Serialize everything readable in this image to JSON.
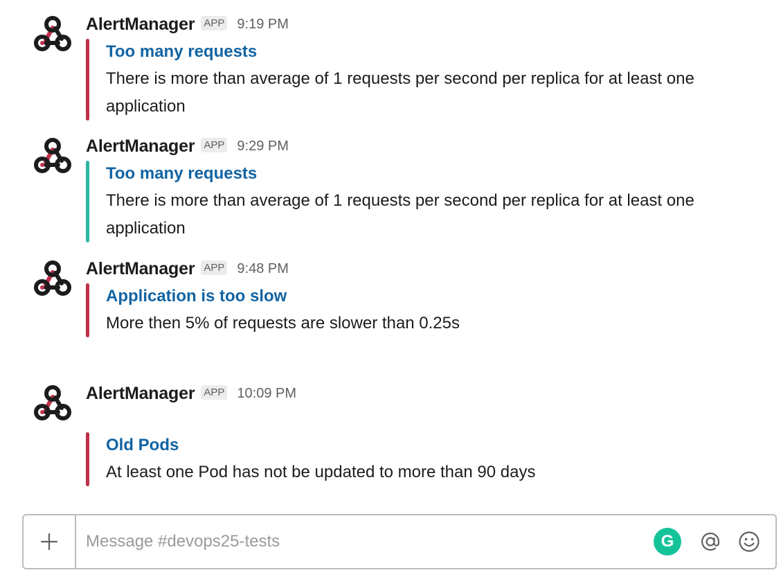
{
  "colors": {
    "alert_red": "#c0304a",
    "resolved_green": "#2eb6a4",
    "link_blue": "#1264a3",
    "grammarly_green": "#15c39a"
  },
  "messages": [
    {
      "sender": "AlertManager",
      "badge": "APP",
      "time": "9:19 PM",
      "avatar_icon": "webhook-icon",
      "attachment": {
        "color": "#c0304a",
        "title": "Too many requests",
        "text": "There is more than average of 1 requests per second per replica for at least one application"
      }
    },
    {
      "sender": "AlertManager",
      "badge": "APP",
      "time": "9:29 PM",
      "avatar_icon": "webhook-icon",
      "attachment": {
        "color": "#2eb6a4",
        "title": "Too many requests",
        "text": "There is more than average of 1 requests per second per replica for at least one application"
      }
    },
    {
      "sender": "AlertManager",
      "badge": "APP",
      "time": "9:48 PM",
      "avatar_icon": "webhook-icon",
      "attachment": {
        "color": "#c0304a",
        "title": "Application is too slow",
        "text": "More then 5% of requests are slower than 0.25s"
      }
    },
    {
      "sender": "AlertManager",
      "badge": "APP",
      "time": "10:09 PM",
      "avatar_icon": "webhook-icon",
      "attachment": {
        "color": "#c0304a",
        "title": "Old Pods",
        "text": "At least one Pod has not be updated to more than 90 days"
      }
    }
  ],
  "composer": {
    "placeholder": "Message #devops25-tests",
    "plus_icon": "plus-icon",
    "grammarly_icon": "grammarly-icon",
    "grammarly_letter": "G",
    "mention_icon": "at-mention-icon",
    "emoji_icon": "emoji-icon"
  }
}
